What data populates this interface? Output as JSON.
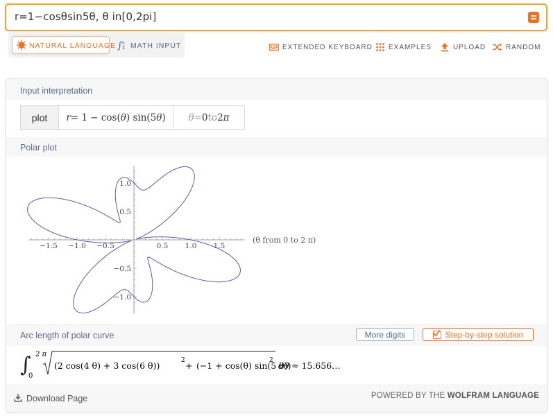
{
  "search": {
    "query": "r=1−cosθsin5θ, θ in[0,2pi]"
  },
  "modes": {
    "natural_language": "NATURAL LANGUAGE",
    "math_input": "MATH INPUT"
  },
  "toolbar": {
    "extended_keyboard": "EXTENDED KEYBOARD",
    "examples": "EXAMPLES",
    "upload": "UPLOAD",
    "random": "RANDOM"
  },
  "pods": {
    "input_interpretation": {
      "title": "Input interpretation",
      "command": "plot",
      "expr_lhs": "r",
      "expr_rhs_a": " = 1 − cos(",
      "theta": "θ",
      "expr_rhs_b": ") sin(5 ",
      "expr_rhs_c": ")",
      "range_eq": " = ",
      "range_from": "0",
      "range_to_word": " to ",
      "range_to": "2 ",
      "pi": "π"
    },
    "polar_plot": {
      "title": "Polar plot",
      "axis_note": "(θ from 0 to 2 π)"
    },
    "arc_length": {
      "title": "Arc length of polar curve",
      "more_digits": "More digits",
      "step_by_step": "Step-by-step solution",
      "lower_limit": "0",
      "upper_limit": "2 π",
      "term1": "(2 cos(4 θ) + 3 cos(6 θ))",
      "plus": " + ",
      "term2": "(−1 + cos(θ) sin(5 θ))",
      "exp": "2",
      "dtheta": "dθ",
      "result": "≈ 15.656…"
    }
  },
  "footer": {
    "download": "Download Page",
    "powered_prefix": "POWERED BY THE ",
    "powered_brand": "WOLFRAM LANGUAGE"
  },
  "colors": {
    "accent": "#f26f21",
    "search_border": "#f5a623",
    "curve": "#5a5aa8",
    "pod_title": "#5a6b8a"
  },
  "chart_data": {
    "type": "line",
    "title": "",
    "equation": "r = 1 − cos(θ) sin(5θ)",
    "theta_range": [
      0,
      6.283185307
    ],
    "samples": 720,
    "xlim": [
      -1.85,
      1.95
    ],
    "ylim": [
      -1.3,
      1.3
    ],
    "x_ticks": [
      -1.5,
      -1.0,
      -0.5,
      0.5,
      1.0,
      1.5
    ],
    "x_tick_labels": [
      "−1.5",
      "−1.0",
      "−0.5",
      "0.5",
      "1.0",
      "1.5"
    ],
    "y_ticks": [
      1.0,
      0.5,
      -0.5,
      -1.0
    ],
    "y_tick_labels": [
      "1.0",
      "0.5",
      "−0.5",
      "−1.0"
    ],
    "grid": false,
    "legend": "none"
  }
}
